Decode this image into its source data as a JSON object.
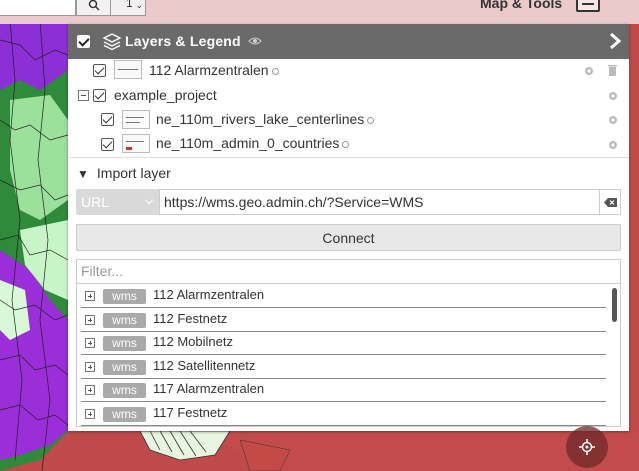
{
  "topbar": {
    "search_value": "",
    "zoom_select_value": "1",
    "maptools_label": "Map & Tools"
  },
  "panel": {
    "title": "Layers & Legend",
    "layers": [
      {
        "label": "112 Alarmzentralen",
        "checked": true,
        "has_info": true,
        "has_trash": true
      },
      {
        "label": "example_project",
        "checked": true,
        "group": true
      },
      {
        "label": "ne_110m_rivers_lake_centerlines",
        "checked": true,
        "has_info": true
      },
      {
        "label": "ne_110m_admin_0_countries",
        "checked": true,
        "has_info": true
      }
    ]
  },
  "import": {
    "header": "Import layer",
    "type_select": "URL",
    "url_value": "https://wms.geo.admin.ch/?Service=WMS",
    "connect_label": "Connect",
    "filter_placeholder": "Filter...",
    "results": [
      {
        "badge": "wms",
        "label": "112 Alarmzentralen"
      },
      {
        "badge": "wms",
        "label": "112 Festnetz"
      },
      {
        "badge": "wms",
        "label": "112 Mobilnetz"
      },
      {
        "badge": "wms",
        "label": "112 Satellitennetz"
      },
      {
        "badge": "wms",
        "label": "117 Alarmzentralen"
      },
      {
        "badge": "wms",
        "label": "117 Festnetz"
      }
    ]
  },
  "colors": {
    "panel_header": "#6a6a6a",
    "map_background": "#c0494a",
    "topbar": "#eccacc",
    "badge": "#a9a9a9"
  }
}
